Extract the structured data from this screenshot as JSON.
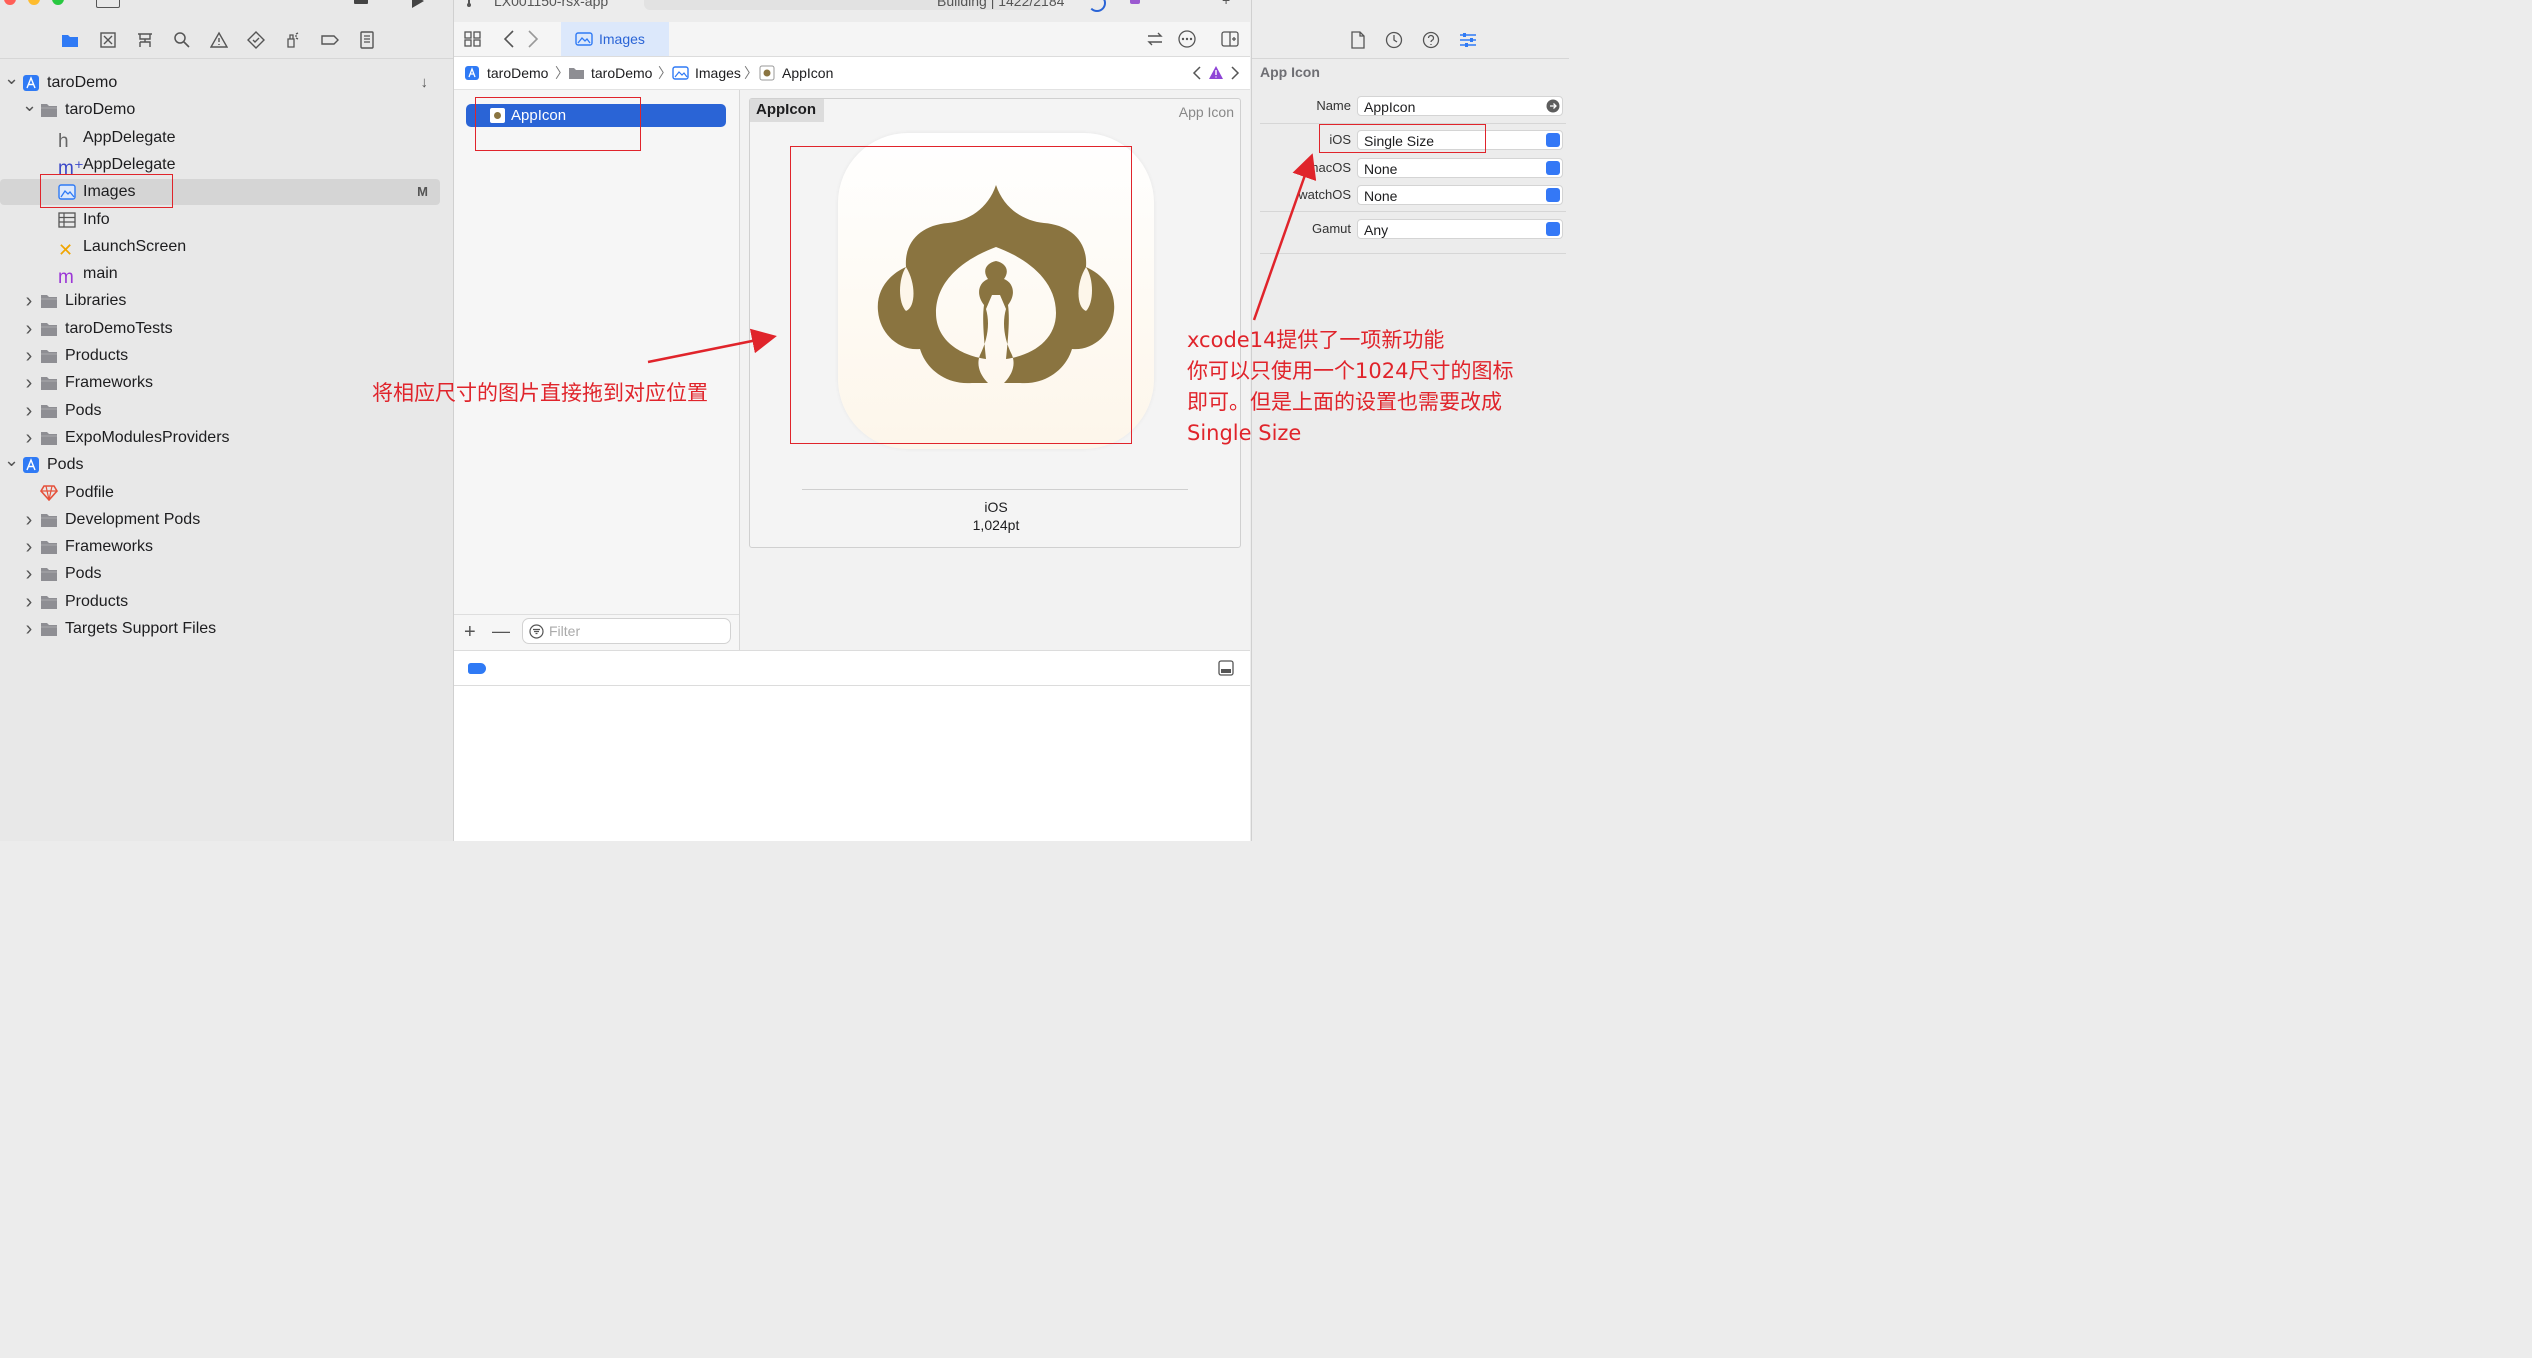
{
  "toolbar": {
    "scheme": "LX001150-rsx-app",
    "status_text": "Building | 1422/2184"
  },
  "navigator": {
    "items": [
      {
        "label": "taroDemo",
        "icon": "app-project-icon",
        "badge": "",
        "expanded": true
      },
      {
        "label": "taroDemo",
        "icon": "folder-icon",
        "expanded": true
      },
      {
        "label": "AppDelegate",
        "icon": "header-file-icon",
        "glyph": "h"
      },
      {
        "label": "AppDelegate",
        "icon": "objc-file-icon",
        "glyph": "m⁺"
      },
      {
        "label": "Images",
        "icon": "asset-catalog-icon",
        "badge": "M",
        "selected": true
      },
      {
        "label": "Info",
        "icon": "plist-icon"
      },
      {
        "label": "LaunchScreen",
        "icon": "storyboard-icon",
        "glyph": "✕"
      },
      {
        "label": "main",
        "icon": "m-file-icon",
        "glyph": "m"
      },
      {
        "label": "Libraries",
        "icon": "folder-icon"
      },
      {
        "label": "taroDemoTests",
        "icon": "folder-icon"
      },
      {
        "label": "Products",
        "icon": "folder-icon"
      },
      {
        "label": "Frameworks",
        "icon": "folder-icon"
      },
      {
        "label": "Pods",
        "icon": "folder-icon"
      },
      {
        "label": "ExpoModulesProviders",
        "icon": "folder-icon"
      },
      {
        "label": "Pods",
        "icon": "app-project-icon",
        "expanded": true
      },
      {
        "label": "Podfile",
        "icon": "podfile-icon"
      },
      {
        "label": "Development Pods",
        "icon": "folder-icon"
      },
      {
        "label": "Frameworks",
        "icon": "folder-icon"
      },
      {
        "label": "Pods",
        "icon": "folder-icon"
      },
      {
        "label": "Products",
        "icon": "folder-icon"
      },
      {
        "label": "Targets Support Files",
        "icon": "folder-icon"
      }
    ]
  },
  "editor": {
    "tab_label": "Images",
    "breadcrumb": [
      "taroDemo",
      "taroDemo",
      "Images",
      "AppIcon"
    ],
    "asset_list": {
      "selected_item": "AppIcon",
      "filter_placeholder": "Filter",
      "add_label": "+",
      "remove_label": "—"
    },
    "canvas": {
      "asset_title": "AppIcon",
      "asset_type": "App Icon",
      "platform_label": "iOS",
      "size_label": "1,024pt",
      "icon_fg_color": "#8a7440",
      "icon_bg_color": "#fdf7ee"
    }
  },
  "inspector": {
    "section_title": "App Icon",
    "name_label": "Name",
    "name_value": "AppIcon",
    "ios_label": "iOS",
    "ios_value": "Single Size",
    "macos_label": "macOS",
    "macos_value": "None",
    "watchos_label": "watchOS",
    "watchos_value": "None",
    "gamut_label": "Gamut",
    "gamut_value": "Any"
  },
  "annotations": {
    "drag_hint": "将相应尺寸的图片直接拖到对应位置",
    "feature_line1": "xcode14提供了一项新功能",
    "feature_line2": "你可以只使用一个1024尺寸的图标",
    "feature_line3": "即可。但是上面的设置也需要改成",
    "feature_line4": "Single Size",
    "color": "#e0242b"
  },
  "colors": {
    "accent": "#2a64d6",
    "selection": "#d5d5d5"
  }
}
